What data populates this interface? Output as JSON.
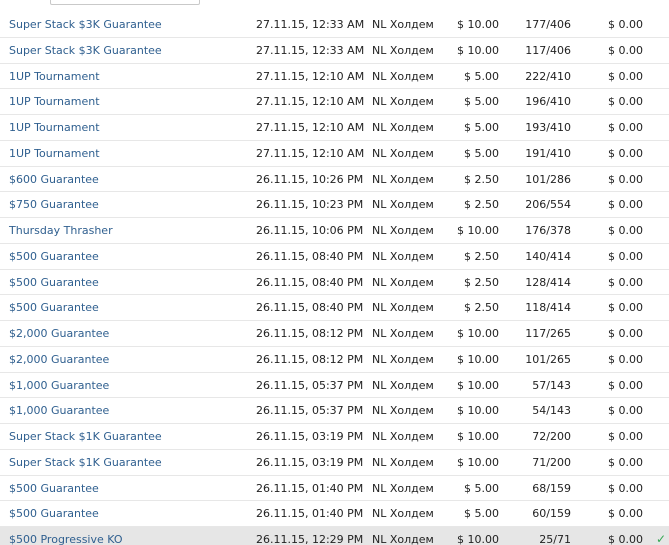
{
  "rows": [
    {
      "name": "Super Stack $3K Guarantee",
      "date": "27.11.15, 12:33 AM",
      "game": "NL Холдем",
      "buyin": "$ 10.00",
      "entries": "177/406",
      "prize": "$ 0.00"
    },
    {
      "name": "Super Stack $3K Guarantee",
      "date": "27.11.15, 12:33 AM",
      "game": "NL Холдем",
      "buyin": "$ 10.00",
      "entries": "117/406",
      "prize": "$ 0.00"
    },
    {
      "name": "1UP Tournament",
      "date": "27.11.15, 12:10 AM",
      "game": "NL Холдем",
      "buyin": "$ 5.00",
      "entries": "222/410",
      "prize": "$ 0.00"
    },
    {
      "name": "1UP Tournament",
      "date": "27.11.15, 12:10 AM",
      "game": "NL Холдем",
      "buyin": "$ 5.00",
      "entries": "196/410",
      "prize": "$ 0.00"
    },
    {
      "name": "1UP Tournament",
      "date": "27.11.15, 12:10 AM",
      "game": "NL Холдем",
      "buyin": "$ 5.00",
      "entries": "193/410",
      "prize": "$ 0.00"
    },
    {
      "name": "1UP Tournament",
      "date": "27.11.15, 12:10 AM",
      "game": "NL Холдем",
      "buyin": "$ 5.00",
      "entries": "191/410",
      "prize": "$ 0.00"
    },
    {
      "name": "$600 Guarantee",
      "date": "26.11.15, 10:26 PM",
      "game": "NL Холдем",
      "buyin": "$ 2.50",
      "entries": "101/286",
      "prize": "$ 0.00"
    },
    {
      "name": "$750 Guarantee",
      "date": "26.11.15, 10:23 PM",
      "game": "NL Холдем",
      "buyin": "$ 2.50",
      "entries": "206/554",
      "prize": "$ 0.00"
    },
    {
      "name": "Thursday Thrasher",
      "date": "26.11.15, 10:06 PM",
      "game": "NL Холдем",
      "buyin": "$ 10.00",
      "entries": "176/378",
      "prize": "$ 0.00"
    },
    {
      "name": "$500 Guarantee",
      "date": "26.11.15, 08:40 PM",
      "game": "NL Холдем",
      "buyin": "$ 2.50",
      "entries": "140/414",
      "prize": "$ 0.00"
    },
    {
      "name": "$500 Guarantee",
      "date": "26.11.15, 08:40 PM",
      "game": "NL Холдем",
      "buyin": "$ 2.50",
      "entries": "128/414",
      "prize": "$ 0.00"
    },
    {
      "name": "$500 Guarantee",
      "date": "26.11.15, 08:40 PM",
      "game": "NL Холдем",
      "buyin": "$ 2.50",
      "entries": "118/414",
      "prize": "$ 0.00"
    },
    {
      "name": "$2,000 Guarantee",
      "date": "26.11.15, 08:12 PM",
      "game": "NL Холдем",
      "buyin": "$ 10.00",
      "entries": "117/265",
      "prize": "$ 0.00"
    },
    {
      "name": "$2,000 Guarantee",
      "date": "26.11.15, 08:12 PM",
      "game": "NL Холдем",
      "buyin": "$ 10.00",
      "entries": "101/265",
      "prize": "$ 0.00"
    },
    {
      "name": "$1,000 Guarantee",
      "date": "26.11.15, 05:37 PM",
      "game": "NL Холдем",
      "buyin": "$ 10.00",
      "entries": "57/143",
      "prize": "$ 0.00"
    },
    {
      "name": "$1,000 Guarantee",
      "date": "26.11.15, 05:37 PM",
      "game": "NL Холдем",
      "buyin": "$ 10.00",
      "entries": "54/143",
      "prize": "$ 0.00"
    },
    {
      "name": "Super Stack $1K Guarantee",
      "date": "26.11.15, 03:19 PM",
      "game": "NL Холдем",
      "buyin": "$ 10.00",
      "entries": "72/200",
      "prize": "$ 0.00"
    },
    {
      "name": "Super Stack $1K Guarantee",
      "date": "26.11.15, 03:19 PM",
      "game": "NL Холдем",
      "buyin": "$ 10.00",
      "entries": "71/200",
      "prize": "$ 0.00"
    },
    {
      "name": "$500 Guarantee",
      "date": "26.11.15, 01:40 PM",
      "game": "NL Холдем",
      "buyin": "$ 5.00",
      "entries": "68/159",
      "prize": "$ 0.00"
    },
    {
      "name": "$500 Guarantee",
      "date": "26.11.15, 01:40 PM",
      "game": "NL Холдем",
      "buyin": "$ 5.00",
      "entries": "60/159",
      "prize": "$ 0.00"
    },
    {
      "name": "$500 Progressive KO",
      "date": "26.11.15, 12:29 PM",
      "game": "NL Холдем",
      "buyin": "$ 10.00",
      "entries": "25/71",
      "prize": "$ 0.00",
      "selected": true
    }
  ],
  "colors": {
    "link": "#2f5f8f",
    "selected_row": "#e6e6e6",
    "check": "#34a853"
  },
  "icons": {
    "selected_row_icon": "check-icon"
  }
}
